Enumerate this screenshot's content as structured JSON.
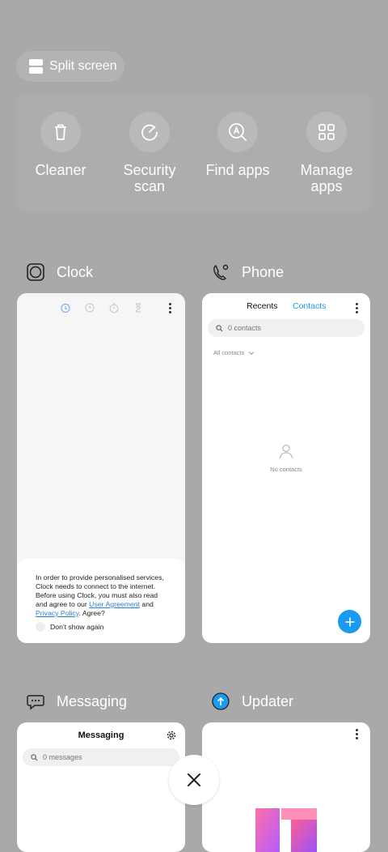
{
  "split_screen": {
    "label": "Split screen",
    "icon": "split-screen-icon"
  },
  "tools": [
    {
      "line1": "Cleaner",
      "line2": "",
      "icon": "trash-icon"
    },
    {
      "line1": "Security",
      "line2": "scan",
      "icon": "security-scan-icon"
    },
    {
      "line1": "Find apps",
      "line2": "",
      "icon": "find-apps-icon"
    },
    {
      "line1": "Manage",
      "line2": "apps",
      "icon": "grid-icon"
    }
  ],
  "apps": {
    "clock": {
      "name": "Clock",
      "consent": {
        "text_before": "In order to provide personalised services, Clock needs to connect to the internet. Before using Clock, you must also read and agree to our ",
        "link1": "User Agreement",
        "and": " and ",
        "link2": "Privacy Policy",
        "text_after": ". Agree?",
        "dont_show": "Don't show again"
      }
    },
    "phone": {
      "name": "Phone",
      "tab_recents": "Recents",
      "tab_contacts": "Contacts",
      "search_placeholder": "0 contacts",
      "filter": "All contacts",
      "empty": "No contacts"
    },
    "messaging": {
      "name": "Messaging",
      "title": "Messaging",
      "search_placeholder": "0 messages"
    },
    "updater": {
      "name": "Updater"
    }
  },
  "colors": {
    "accent": "#1a9bf0",
    "link": "#2a7fd8",
    "background": "#a9a9a9"
  }
}
